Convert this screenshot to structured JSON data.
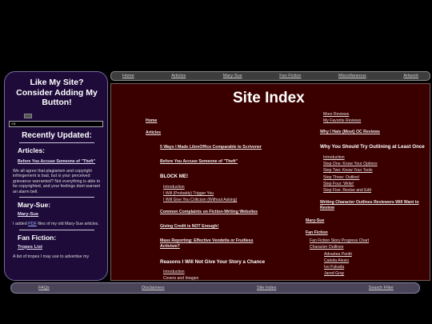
{
  "topnav": [
    "Home",
    "Articles",
    "Mary-Sue",
    "Fan Fiction",
    "Miscellaneous",
    "Artwork"
  ],
  "sidebar": {
    "title": "Like My Site? Consider Adding My Button!",
    "code_value": "<a",
    "recent_heading": "Recently Updated:",
    "articles_heading": "Articles:",
    "article_link": "Before You Accuse Someone of \"Theft\"",
    "article_blurb": "We all agree that plagiarism and copyright infringement is bad, but is your perceived grievance warranted? Not everything is able to be copyrighted, and your feelings dont warrant an alarm bell.",
    "marysue_heading": "Mary-Sue:",
    "marysue_link": "Mary-Sue",
    "marysue_blurb_pre": "I added ",
    "marysue_blurb_pdf": "PDF",
    "marysue_blurb_post": " files of my old Mary-Sue articles.",
    "fanfic_heading": "Fan Fiction:",
    "fanfic_link": "Tropes List",
    "fanfic_blurb": "A list of tropes I may use to advertise my"
  },
  "main": {
    "title": "Site Index",
    "left": {
      "home": "Home",
      "articles": "Articles",
      "a1": "5 Ways I Made LibreOffice Comparable to Scrivener",
      "a2": "Before You Accuse Someone of \"Theft\"",
      "h_block": "BLOCK ME!",
      "b1": "Introduction",
      "b2": "I Will (Probably) Trigger You",
      "b3": "I Will Give You Criticism (Without Asking)",
      "a3": "Common Complaints on Fiction-Writing Websites",
      "a4": "Giving Credit is NOT Enough!",
      "a5": "Mass Reporting: Effective Vendetta or Fruitless Activism?",
      "h_reasons": "Reasons I Will Not Give Your Story a Chance",
      "r1": "Introduction",
      "r2": "Covers and Images"
    },
    "right": {
      "r_more": "More Reviews",
      "r_fav": "My Favorite Reviews",
      "why_hate": "Why I Hate (Most) OC Reviews",
      "h_outline": "Why You Should Try Outlining at Least Once",
      "o1": "Introduction",
      "o2": "Step One: Know Your Options",
      "o3": "Step Two: Know Your Tools",
      "o4": "Step Three: Outline!",
      "o5": "Step Four: Write!",
      "o6": "Step Five: Revise and Edit",
      "writing_outlines": "Writing Character Outlines Reviewers Will Want to Review",
      "marysue": "Mary-Sue",
      "fanfic": "Fan Fiction",
      "f1": "Fan Fiction Story Progress Chart",
      "f2": "Character Outlines",
      "c1": "Adrastea Pentti",
      "c2": "Caleda Alesio",
      "c3": "Ivo Fukuda",
      "c4": "Jared Gray"
    }
  },
  "botnav": [
    "FAQs",
    "Disclaimers",
    "Site Index",
    "Search Filter"
  ]
}
